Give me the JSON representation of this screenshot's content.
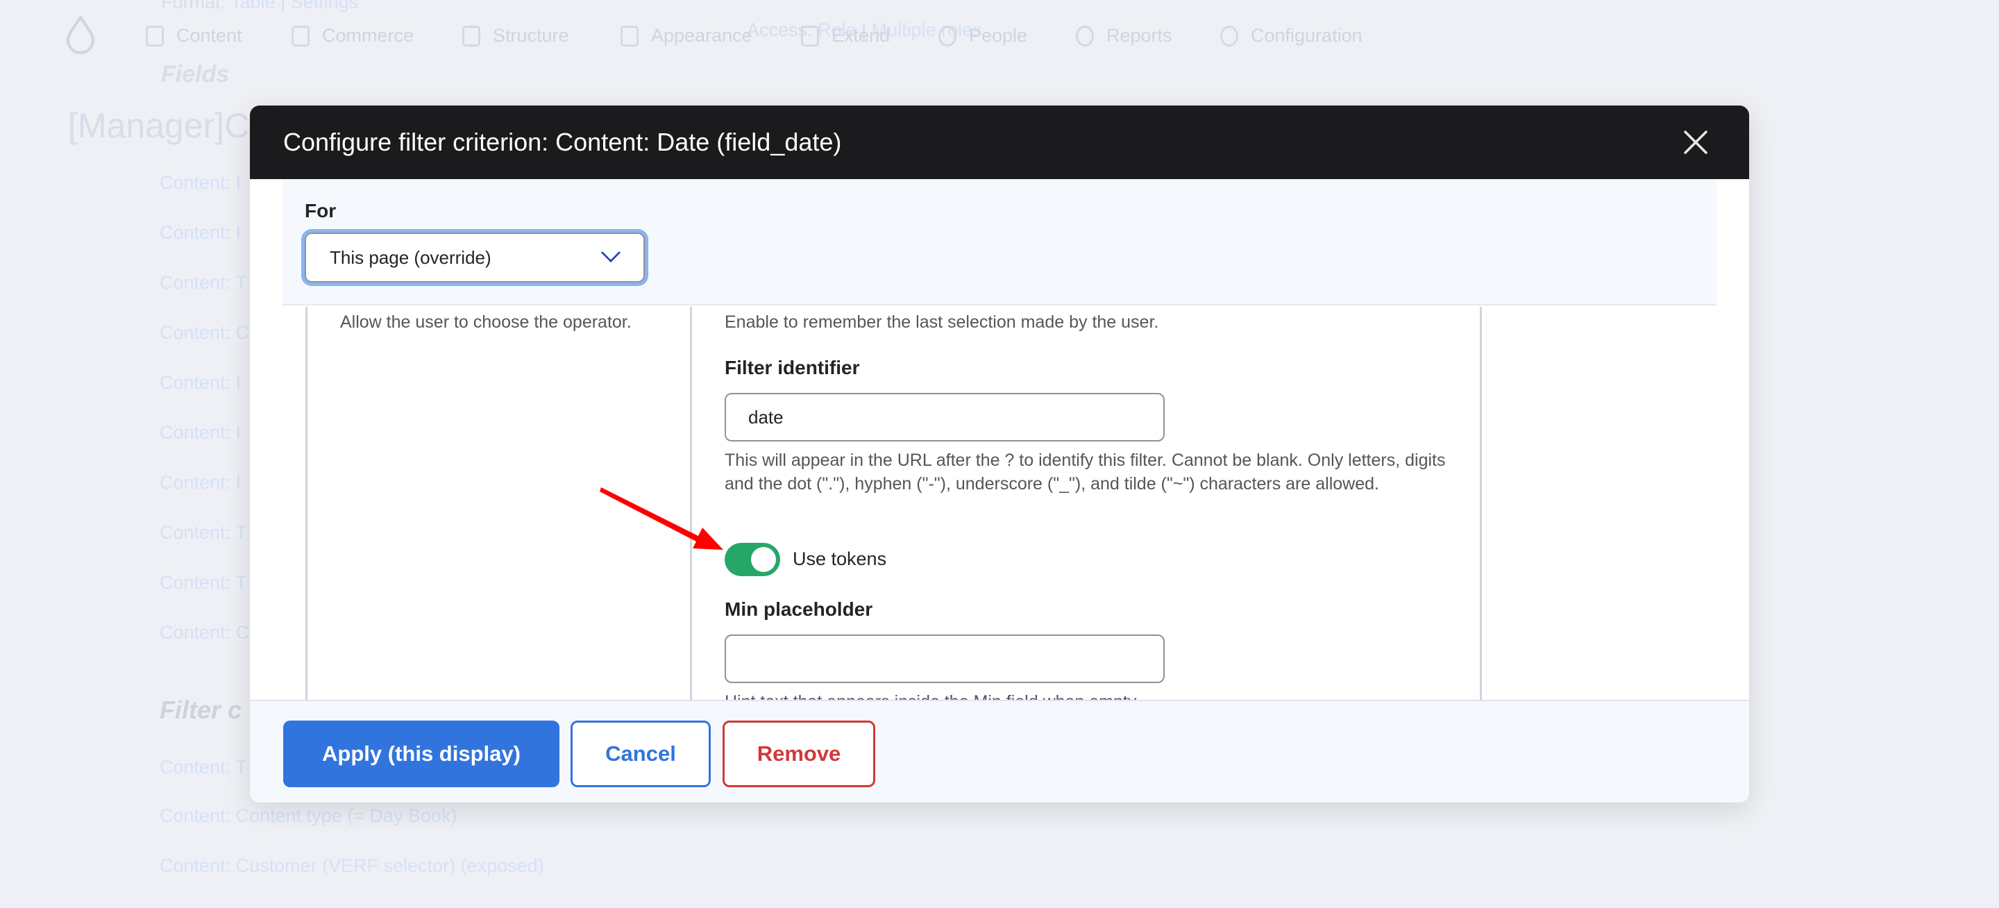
{
  "background": {
    "format_label": "Format:",
    "format_table": "Table",
    "format_settings": "Settings",
    "access_label": "Access:",
    "access_role": "Role",
    "access_multiple": "Multiple roles",
    "fields_heading": "Fields",
    "page_title": "[Manager]Co",
    "field_rows": [
      "Content: I",
      "Content: I",
      "Content: T",
      "Content: C",
      "Content: I",
      "Content: I",
      "Content: I",
      "Content: T",
      "Content: T",
      "Content: C"
    ],
    "filter_heading": "Filter c",
    "filter_rows": [
      "Content: T",
      "Content: Content type (= Day Book)",
      "Content: Customer (VERF selector) (exposed)"
    ]
  },
  "nav": {
    "items": [
      {
        "label": "Content",
        "icon": "file-icon"
      },
      {
        "label": "Commerce",
        "icon": "cart-icon"
      },
      {
        "label": "Structure",
        "icon": "layers-icon"
      },
      {
        "label": "Appearance",
        "icon": "brush-icon"
      },
      {
        "label": "Extend",
        "icon": "puzzle-icon"
      },
      {
        "label": "People",
        "icon": "person-icon"
      },
      {
        "label": "Reports",
        "icon": "chart-icon"
      },
      {
        "label": "Configuration",
        "icon": "gear-icon"
      }
    ]
  },
  "modal": {
    "title": "Configure filter criterion: Content: Date (field_date)",
    "for_label": "For",
    "for_value": "This page (override)",
    "operator_help": "Allow the user to choose the operator.",
    "remember_help": "Enable to remember the last selection made by the user.",
    "identifier_label": "Filter identifier",
    "identifier_value": "date",
    "identifier_help": "This will appear in the URL after the ? to identify this filter. Cannot be blank. Only letters, digits and the dot (\".\"), hyphen (\"-\"), underscore (\"_\"), and tilde (\"~\") characters are allowed.",
    "use_tokens_label": "Use tokens",
    "use_tokens_on": true,
    "min_placeholder_label": "Min placeholder",
    "min_placeholder_value": "",
    "min_placeholder_help": "Hint text that appears inside the Min field when empty.",
    "apply_label": "Apply (this display)",
    "cancel_label": "Cancel",
    "remove_label": "Remove"
  },
  "colors": {
    "primary": "#3274de",
    "danger": "#d0393b",
    "toggle": "#26a769",
    "annotation": "#ff0000"
  }
}
